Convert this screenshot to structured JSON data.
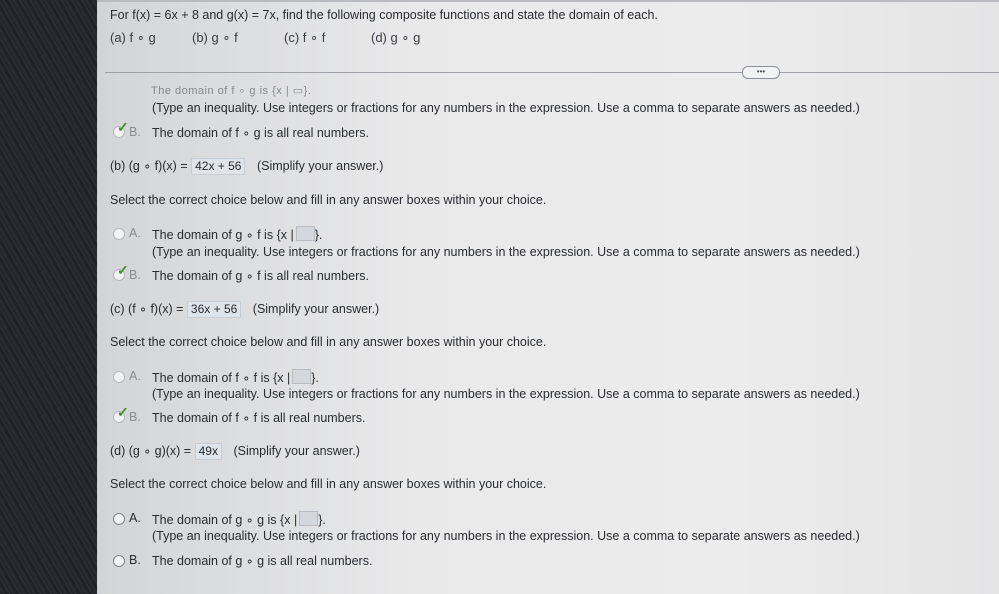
{
  "question": {
    "stem": "For f(x) = 6x + 8 and g(x) = 7x, find the following composite functions and state the domain of each.",
    "parts": [
      "(a) f ∘ g",
      "(b) g ∘ f",
      "(c) f ∘ f",
      "(d) g ∘ g"
    ]
  },
  "more_button": "•••",
  "part_a": {
    "cut_text": "The domain of f ∘ g is {x | ▭}.",
    "hint": "(Type an inequality. Use integers or fractions for any numbers in the expression. Use a comma to separate answers as needed.)",
    "choice_b": {
      "letter": "B.",
      "text": "The domain of f ∘ g is all real numbers."
    }
  },
  "part_b": {
    "prompt_prefix": "(b) (g ∘ f)(x) =",
    "answer": "42x + 56",
    "suffix": "(Simplify your answer.)",
    "select": "Select the correct choice below and fill in any answer boxes within your choice.",
    "choice_a": {
      "letter": "A.",
      "pre": "The domain of g ∘ f is",
      "open": "{x |",
      "close": "}."
    },
    "hint": "(Type an inequality. Use integers or fractions for any numbers in the expression. Use a comma to separate answers as needed.)",
    "choice_b": {
      "letter": "B.",
      "text": "The domain of g ∘ f is all real numbers."
    }
  },
  "part_c": {
    "prompt_prefix": "(c) (f ∘ f)(x) =",
    "answer": "36x + 56",
    "suffix": "(Simplify your answer.)",
    "select": "Select the correct choice below and fill in any answer boxes within your choice.",
    "choice_a": {
      "letter": "A.",
      "pre": "The domain of f ∘ f is",
      "open": "{x |",
      "close": "}."
    },
    "hint": "(Type an inequality. Use integers or fractions for any numbers in the expression. Use a comma to separate answers as needed.)",
    "choice_b": {
      "letter": "B.",
      "text": "The domain of f ∘ f is all real numbers."
    }
  },
  "part_d": {
    "prompt_prefix": "(d) (g ∘ g)(x) =",
    "answer": "49x",
    "suffix": "(Simplify your answer.)",
    "select": "Select the correct choice below and fill in any answer boxes within your choice.",
    "choice_a": {
      "letter": "A.",
      "pre": "The domain of g ∘ g is",
      "open": "{x |",
      "close": "}."
    },
    "hint": "(Type an inequality. Use integers or fractions for any numbers in the expression. Use a comma to separate answers as needed.)",
    "choice_b": {
      "letter": "B.",
      "text": "The domain of g ∘ g is all real numbers."
    }
  },
  "colors": {
    "check": "#3f8f2a",
    "answer_box": "#dfe3ea",
    "screen": "#ececec"
  }
}
